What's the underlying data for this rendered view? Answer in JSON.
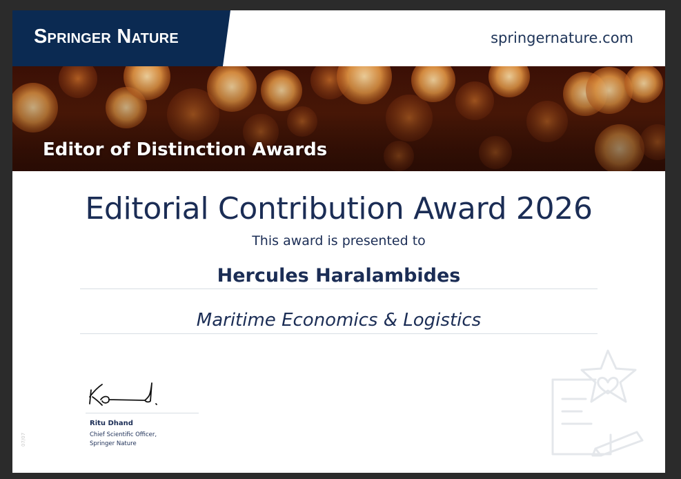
{
  "header": {
    "brand": "Springer Nature",
    "website": "springernature.com",
    "brand_color": "#0b2a52"
  },
  "banner": {
    "title": "Editor of Distinction Awards"
  },
  "award": {
    "title": "Editorial Contribution Award 2026",
    "presented_text": "This award is presented to",
    "recipient": "Hercules Haralambides",
    "journal": "Maritime Economics & Logistics"
  },
  "signatory": {
    "name": "Ritu Dhand",
    "role_line1": "Chief Scientific Officer,",
    "role_line2": "Springer Nature"
  },
  "footer": {
    "code": "07/07"
  },
  "decoration": {
    "icon": "certificate-star-heart-icon"
  },
  "colors": {
    "text": "#1b2d55",
    "rule": "#d7dde3"
  }
}
